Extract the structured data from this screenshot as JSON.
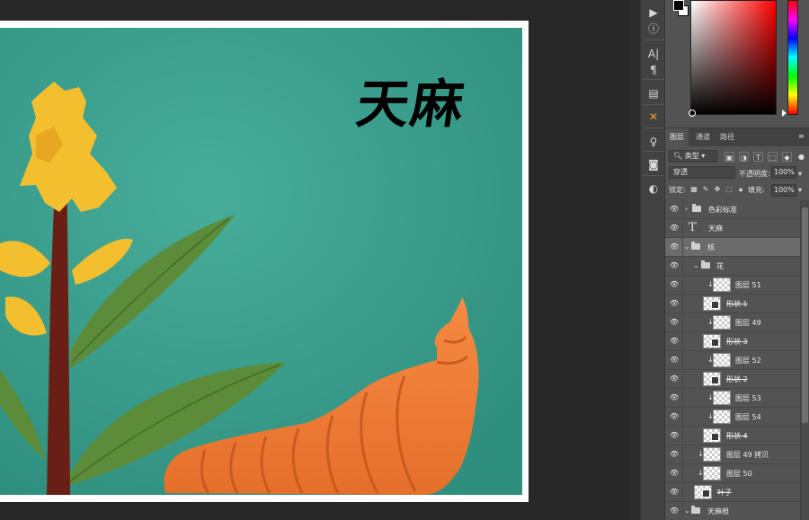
{
  "artwork": {
    "title": "天麻"
  },
  "tools": [
    "play-icon",
    "info-icon",
    "character-icon",
    "paragraph-icon",
    "stamp-icon",
    "crosshair-icon",
    "tool-preset-icon",
    "camera-icon",
    "adjust-icon"
  ],
  "colors": {
    "foreground": "#000000",
    "background": "#ffffff",
    "canvas_bg": "#3fa695",
    "tuber": "#f07f38",
    "leaf": "#5c8c3a",
    "flower": "#f4bf2f",
    "stem": "#6a1f16"
  },
  "tabs": {
    "layers": "图层",
    "channels": "通道",
    "paths": "路径"
  },
  "filter": {
    "kind": "类型"
  },
  "blend": {
    "mode": "穿透",
    "opacity_label": "不透明度:",
    "opacity_value": "100%"
  },
  "lock": {
    "label": "锁定:",
    "fill_label": "填充:",
    "fill_value": "100%"
  },
  "layers": {
    "l0": "色彩标准",
    "l1": "天麻",
    "l2": "核",
    "l3": "花",
    "l4": "图层 51",
    "l5": "形状 1",
    "l6": "图层 49",
    "l7": "形状 3",
    "l8": "图层 52",
    "l9": "形状 2",
    "l10": "图层 53",
    "l11": "图层 54",
    "l12": "形状 4",
    "l13": "图层 49 拷贝",
    "l14": "图层 50",
    "l15": "叶子",
    "l16": "天麻根"
  }
}
